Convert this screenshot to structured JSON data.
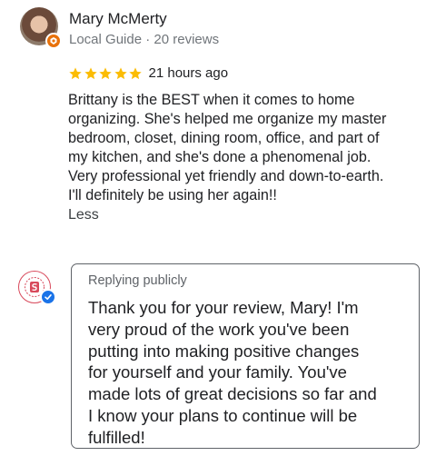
{
  "review": {
    "reviewer_name": "Mary McMerty",
    "reviewer_meta": "Local Guide · 20 reviews",
    "rating": 5,
    "rating_max": 5,
    "time": "21 hours ago",
    "body": "Brittany is the BEST when it comes to home\norganizing. She's helped me organize my master\nbedroom, closet, dining room, office, and part of\nmy kitchen, and she's done a phenomenal job.\nVery professional yet friendly and down-to-earth.\nI'll definitely be using her again!!",
    "less_label": "Less"
  },
  "reply": {
    "label": "Replying publicly",
    "text": "Thank you for your review, Mary! I'm\nvery proud of the work you've been\nputting into making positive changes\nfor yourself and your family. You've\nmade lots of great decisions so far and\nI know your plans to continue will be\nfulfilled!"
  },
  "colors": {
    "star": "#fbbc04",
    "guide_badge": "#e8710a",
    "verified": "#1a73e8",
    "owner_logo": "#d84a5c"
  },
  "icons": {
    "guide_badge": "local-guide-badge-icon",
    "verified": "verified-check-icon",
    "star": "star-icon"
  }
}
